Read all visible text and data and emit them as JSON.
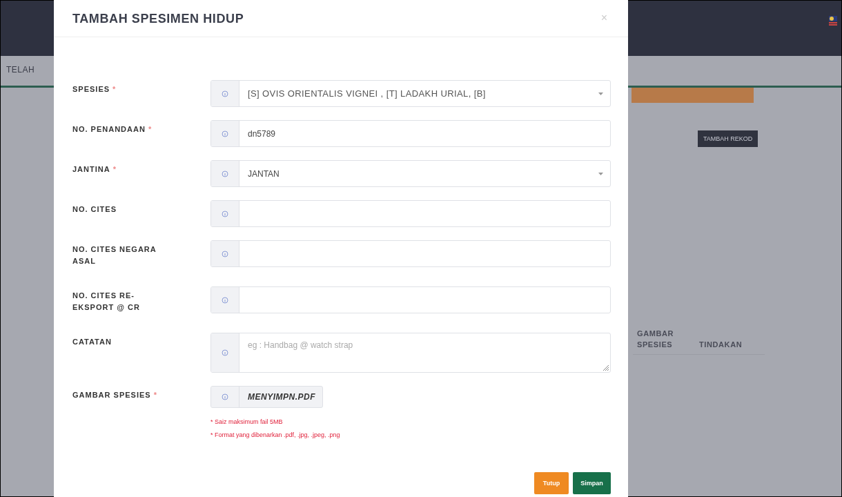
{
  "background": {
    "tab": "TELAH",
    "button": "TAMBAH REKOD",
    "columns": [
      "GAMBAR SPESIES",
      "TINDAKAN"
    ]
  },
  "modal": {
    "title": "TAMBAH SPESIMEN HIDUP",
    "close": "×",
    "fields": [
      {
        "label": "SPESIES",
        "mark": "*",
        "kind": "select",
        "value": "[S] OVIS ORIENTALIS VIGNEI , [T] LADAKH URIAL, [B]"
      },
      {
        "label": "NO. PENANDAAN",
        "mark": "*",
        "kind": "text",
        "value": "dn5789"
      },
      {
        "label": "JANTINA",
        "mark": "*",
        "kind": "select",
        "value": "JANTAN"
      },
      {
        "label": "NO. CITES",
        "kind": "text"
      },
      {
        "label": "NO. CITES NEGARA ASAL",
        "kind": "text"
      },
      {
        "label": "NO. CITES RE-EKSPORT @ CR",
        "kind": "text"
      },
      {
        "label": "CATATAN",
        "kind": "textarea",
        "placeholder": "eg :  Handbag @ watch strap"
      },
      {
        "label": "GAMBAR SPESIES",
        "mark": "*",
        "kind": "file",
        "value": "MENYIMPN.PDF"
      }
    ],
    "notes": [
      "* Saiz maksimum fail 5MB",
      "* Format yang dibenarkan .pdf, .jpg, .jpeg, .png"
    ],
    "buttons": [
      {
        "label": "Tutup",
        "kind": "close"
      },
      {
        "label": "Simpan",
        "kind": "save"
      }
    ]
  }
}
